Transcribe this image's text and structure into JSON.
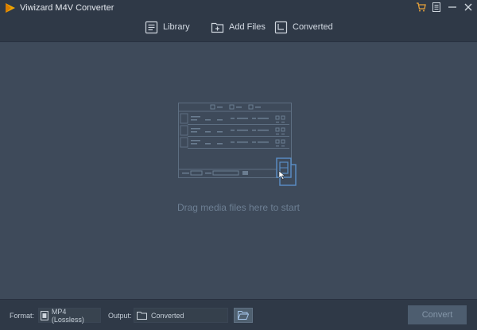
{
  "app": {
    "title": "Viwizard M4V Converter"
  },
  "window_controls": [
    {
      "name": "cart-icon",
      "color": "#e8a23a"
    },
    {
      "name": "menu-icon"
    },
    {
      "name": "minimize-icon"
    },
    {
      "name": "close-icon"
    }
  ],
  "toolbar": {
    "library_label": "Library",
    "add_files_label": "Add Files",
    "converted_label": "Converted"
  },
  "main": {
    "drop_hint": "Drag media files here to start"
  },
  "bottom": {
    "format_label": "Format:",
    "format_value": "MP4 (Lossless)",
    "output_label": "Output:",
    "output_value": "Converted",
    "convert_label": "Convert"
  },
  "colors": {
    "background": "#3e4a5a",
    "bars": "#2f3947",
    "accent": "#5a8fc8",
    "logo": "#f0a500"
  }
}
